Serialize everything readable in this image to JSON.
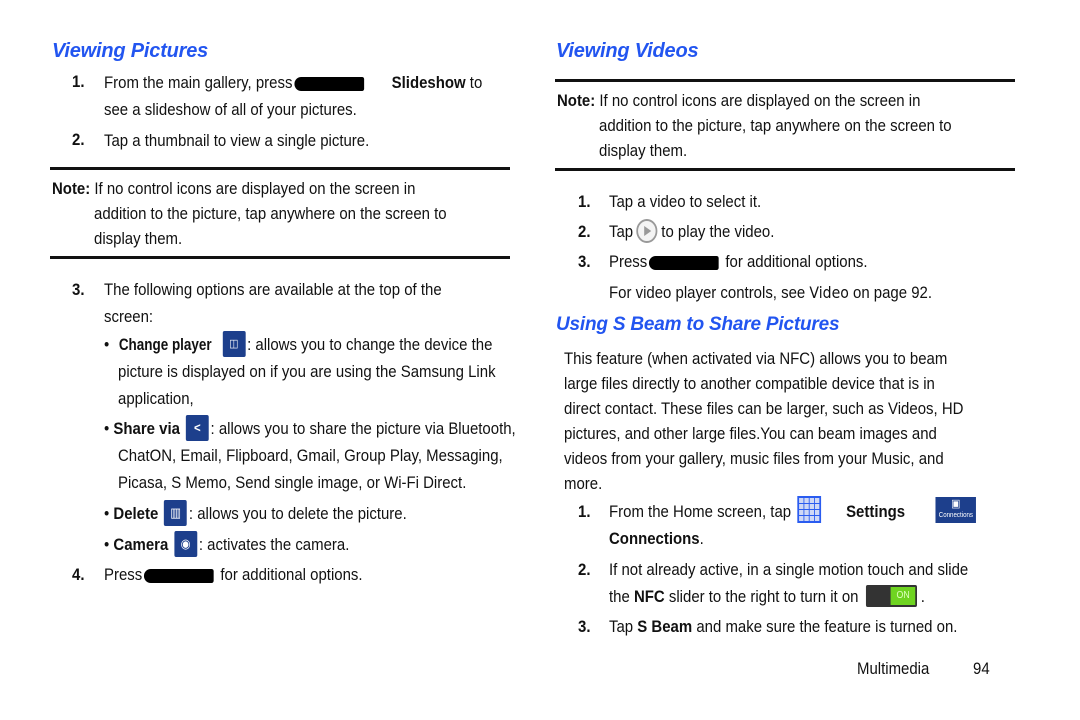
{
  "left": {
    "heading": "Viewing Pictures",
    "step1": {
      "num": "1.",
      "pre": "From the main gallery, press",
      "bold": "Slideshow",
      "post": " to",
      "line2": "see a slideshow of all of your pictures."
    },
    "step2": {
      "num": "2.",
      "text": "Tap a thumbnail to view a single picture."
    },
    "note": {
      "label": "Note:",
      "line1": " If no control icons are displayed on the screen in",
      "line2": "addition to the picture, tap anywhere on the screen to",
      "line3": "display them."
    },
    "step3": {
      "num": "3.",
      "line1": "The following options are available at the top of the",
      "line2": "screen:"
    },
    "bullets": [
      {
        "label": "Change player",
        "icon": "change-player-icon",
        "glyph": "◫",
        "line1": ": allows you to change the device the",
        "line2": "picture is displayed on if you are using the Samsung Link",
        "line3": "application,"
      },
      {
        "label": "Share via",
        "icon": "share-icon",
        "glyph": "<",
        "line1": ": allows you to share the picture via Bluetooth,",
        "line2": "ChatON, Email, Flipboard, Gmail, Group Play, Messaging,",
        "line3": "Picasa, S Memo, Send single image, or Wi-Fi Direct."
      },
      {
        "label": "Delete",
        "icon": "trash-icon",
        "glyph": "🗑",
        "line1": ": allows you to delete the picture."
      },
      {
        "label": "Camera",
        "icon": "camera-icon",
        "glyph": "◉",
        "line1": ": activates the camera."
      }
    ],
    "step4": {
      "num": "4.",
      "pre": "Press",
      "post": "for additional options."
    }
  },
  "right": {
    "heading": "Viewing Videos",
    "note": {
      "label": "Note:",
      "line1": " If no control icons are displayed on the screen in",
      "line2": "addition to the picture, tap anywhere on the screen to",
      "line3": "display them."
    },
    "steps": [
      {
        "num": "1.",
        "text": "Tap a video to select it."
      },
      {
        "num": "2.",
        "pre": "Tap",
        "post": "to play the video."
      },
      {
        "num": "3.",
        "pre": "Press",
        "post": "for additional options."
      }
    ],
    "xref": {
      "pre": "For video player controls, see ",
      "link": "Video",
      "post": " on page 92."
    },
    "heading2": "Using S Beam to Share Pictures",
    "para": [
      "This feature (when activated via NFC) allows you to beam",
      "large files directly to another compatible device that is in",
      "direct contact. These files can be larger, such as Videos, HD",
      "pictures, and other large files.You can beam images and",
      "videos from your gallery, music files from your Music, and",
      "more."
    ],
    "beam_steps": [
      {
        "num": "1.",
        "pre": "From the Home screen, tap",
        "bold": "Settings",
        "conn_label": "Connections",
        "line2_bold": "Connections",
        "line2_post": "."
      },
      {
        "num": "2.",
        "line1": "If not already active, in a single motion touch and slide",
        "pre2": "the ",
        "bold2": "NFC",
        "post2": " slider to the right to turn it on",
        "toggle": "ON",
        "end": "."
      },
      {
        "num": "3.",
        "pre": "Tap ",
        "bold": "S Beam",
        "post": " and make sure the feature is turned on."
      }
    ]
  },
  "footer": {
    "section": "Multimedia",
    "page": "94"
  }
}
